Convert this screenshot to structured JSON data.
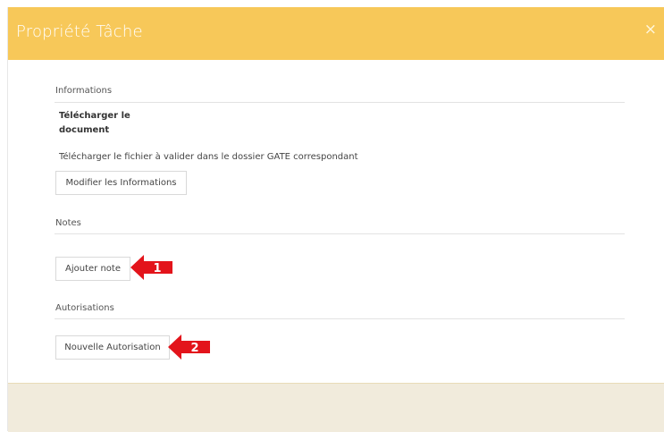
{
  "modal": {
    "title": "Propriété Tâche",
    "close_label": "×"
  },
  "sections": {
    "informations": {
      "title": "Informations",
      "task_name_line1": "Télécharger le",
      "task_name_line2": "document",
      "description": "Télécharger le fichier à valider dans le dossier GATE correspondant",
      "button_label": "Modifier les Informations"
    },
    "notes": {
      "title": "Notes",
      "button_label": "Ajouter note"
    },
    "autorisations": {
      "title": "Autorisations",
      "button_label": "Nouvelle Autorisation"
    }
  },
  "annotations": {
    "marker_1": "1",
    "marker_2": "2",
    "color": "#e3141b"
  },
  "colors": {
    "header": "#f7c859",
    "footer": "#f1ebdc"
  }
}
